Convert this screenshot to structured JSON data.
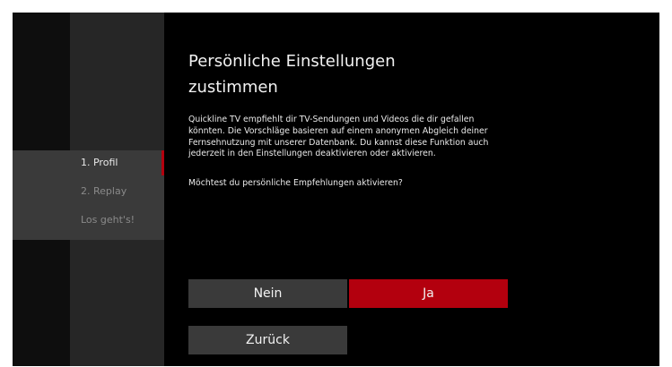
{
  "steps": [
    {
      "label": "1. Profil",
      "state": "active"
    },
    {
      "label": "2. Replay",
      "state": "inactive"
    },
    {
      "label": "Los geht's!",
      "state": "inactive"
    }
  ],
  "dialog": {
    "title": "Persönliche Einstellungen zustimmen",
    "paragraph": "Quickline TV empfiehlt dir TV-Sendungen und Videos die dir gefallen könnten. Die Vorschläge basieren auf einem anonymen Abgleich deiner Fernsehnutzung mit unserer Datenbank. Du kannst diese Funktion auch jederzeit in den Einstellungen deaktivieren oder aktivieren.",
    "question": "Möchtest du persönliche Empfehlungen aktivieren?"
  },
  "buttons": {
    "no_label": "Nein",
    "yes_label": "Ja",
    "back_label": "Zurück"
  },
  "colors": {
    "accent": "#b3000e",
    "background": "#000000",
    "panel": "#262626",
    "button": "#3a3a3a"
  }
}
